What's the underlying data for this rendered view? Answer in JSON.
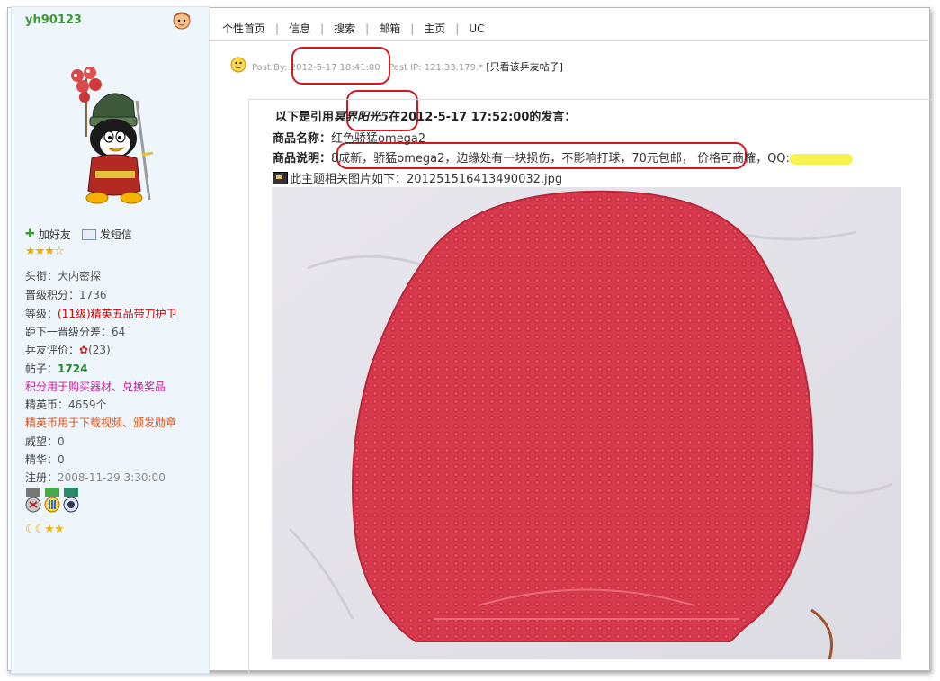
{
  "sidebar": {
    "username": "yh90123",
    "actions": {
      "add_friend": "加好友",
      "send_message": "发短信"
    },
    "rank_stars": "★★★☆",
    "info": {
      "title_label": "头衔：",
      "title_value": "大内密探",
      "points_label": "晋级积分：",
      "points_value": "1736",
      "level_label": "等级：",
      "level_value": "(11级)精英五品带刀护卫",
      "next_label": "距下一晋级分差：",
      "next_value": "64",
      "rating_label": "乒友评价：",
      "rating_value": "(23)",
      "posts_label": "帖子：",
      "posts_value": "1724",
      "points_note": "积分用于购买器材、兑换奖品",
      "coins_label": "精英币：",
      "coins_value": "4659个",
      "coins_note": "精英币用于下载视频、颁发勋章",
      "prestige_label": "威望：",
      "prestige_value": "0",
      "essence_label": "精华：",
      "essence_value": "0",
      "reg_label": "注册：",
      "reg_value": "2008-11-29 3:30:00"
    },
    "moons": "☾☾★★"
  },
  "topnav": {
    "items": [
      "个性首页",
      "信息",
      "搜索",
      "邮箱",
      "主页",
      "UC"
    ],
    "separator": "|"
  },
  "post": {
    "postby_label": "Post By:",
    "postby_time": "2012-5-17 18:41:00",
    "ip_label": "Post IP:",
    "ip_value": "121.33.179.*",
    "only_this_user": "[只看该乒友帖子]"
  },
  "content": {
    "quote_prefix": "以下是引用",
    "quote_author": "冥界阳光5",
    "quote_suffix": "在2012-5-17 17:52:00的发言：",
    "name_label": "商品名称：",
    "name_value": "红色骄猛omega2",
    "desc_label": "商品说明：",
    "desc_value": "8成新，骄猛omega2，边缘处有一块损伤，不影响打球，70元包邮，",
    "price_text": "价格可商榷，QQ:",
    "image_note": "此主题相关图片如下：201251516413490032.jpg"
  },
  "colors": {
    "username": "#3a9a30",
    "highlight_circle": "#d0181e",
    "rubber_red": "#d83b4c"
  }
}
